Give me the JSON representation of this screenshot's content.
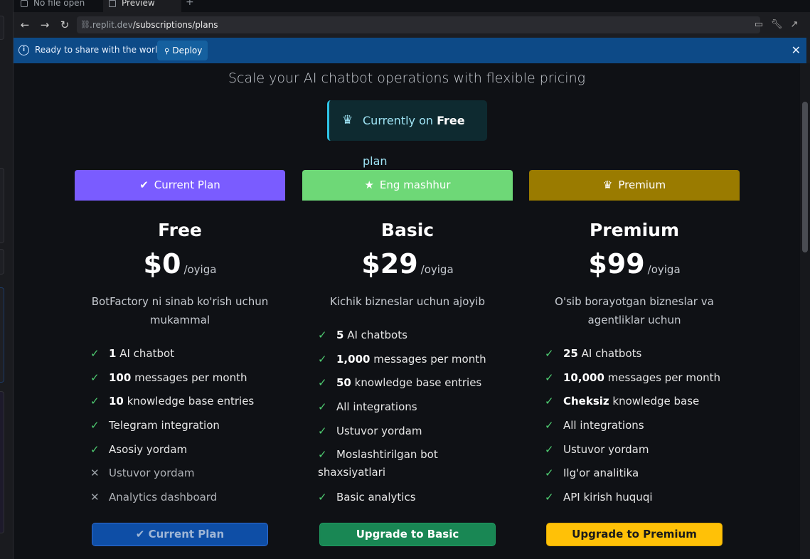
{
  "tabs": [
    {
      "label": "No file open"
    },
    {
      "label": "Preview"
    }
  ],
  "browser": {
    "url_host": ".replit.dev",
    "url_path": "/subscriptions/plans"
  },
  "banner": {
    "message": "Ready to share with the world?",
    "deploy_label": "Deploy"
  },
  "page": {
    "subtitle": "Scale your AI chatbot operations with flexible pricing",
    "current_plan": {
      "prefix": "Currently on",
      "plan": "Free",
      "suffix": "plan"
    }
  },
  "plans": [
    {
      "badge": "Current Plan",
      "badge_color": "#7a5cff",
      "name": "Free",
      "price": "$0",
      "period": "/oyiga",
      "description": "BotFactory ni sinab ko'rish uchun mukammal",
      "features": [
        {
          "strong": "1",
          "text": "AI chatbot",
          "included": true
        },
        {
          "strong": "100",
          "text": "messages per month",
          "included": true
        },
        {
          "strong": "10",
          "text": "knowledge base entries",
          "included": true
        },
        {
          "strong": "",
          "text": "Telegram integration",
          "included": true
        },
        {
          "strong": "",
          "text": "Asosiy yordam",
          "included": true
        },
        {
          "strong": "",
          "text": "Ustuvor yordam",
          "included": false
        },
        {
          "strong": "",
          "text": "Analytics dashboard",
          "included": false
        }
      ],
      "cta": "Current Plan",
      "cta_color": "#0e4ea6"
    },
    {
      "badge": "Eng mashhur",
      "badge_color": "#6ed877",
      "name": "Basic",
      "price": "$29",
      "period": "/oyiga",
      "description": "Kichik bizneslar uchun ajoyib",
      "features": [
        {
          "strong": "5",
          "text": "AI chatbots",
          "included": true
        },
        {
          "strong": "1,000",
          "text": "messages per month",
          "included": true
        },
        {
          "strong": "50",
          "text": "knowledge base entries",
          "included": true
        },
        {
          "strong": "",
          "text": "All integrations",
          "included": true
        },
        {
          "strong": "",
          "text": "Ustuvor yordam",
          "included": true
        },
        {
          "strong": "",
          "text": "Moslashtirilgan bot shaxsiyatlari",
          "included": true
        },
        {
          "strong": "",
          "text": "Basic analytics",
          "included": true
        }
      ],
      "cta": "Upgrade to Basic",
      "cta_color": "#198754"
    },
    {
      "badge": "Premium",
      "badge_color": "#9a7b00",
      "name": "Premium",
      "price": "$99",
      "period": "/oyiga",
      "description": "O'sib borayotgan bizneslar va agentliklar uchun",
      "features": [
        {
          "strong": "25",
          "text": "AI chatbots",
          "included": true
        },
        {
          "strong": "10,000",
          "text": "messages per month",
          "included": true
        },
        {
          "strong": "Cheksiz",
          "text": "knowledge base",
          "included": true
        },
        {
          "strong": "",
          "text": "All integrations",
          "included": true
        },
        {
          "strong": "",
          "text": "Ustuvor yordam",
          "included": true
        },
        {
          "strong": "",
          "text": "Ilg'or analitika",
          "included": true
        },
        {
          "strong": "",
          "text": "API kirish huquqi",
          "included": true
        }
      ],
      "cta": "Upgrade to Premium",
      "cta_color": "#ffc107"
    }
  ]
}
